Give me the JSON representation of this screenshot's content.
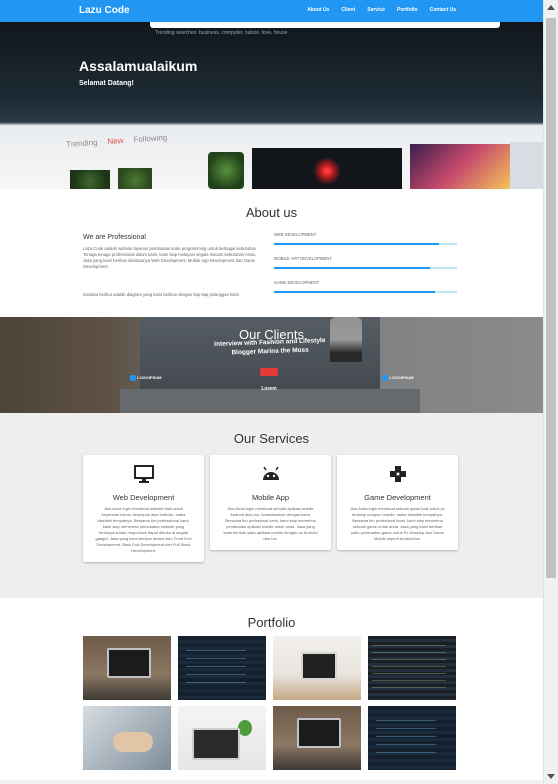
{
  "navbar": {
    "brand": "Lazu Code",
    "links": [
      "About Us",
      "Client",
      "Service",
      "Portfolio",
      "Contact Us"
    ]
  },
  "hero": {
    "trending": "Trending searches: business, computer, nature, love, house",
    "title": "Assalamualaikum",
    "subtitle": "Selamat Datang!",
    "tabs": [
      "Trending",
      "New",
      "Following"
    ]
  },
  "about": {
    "title": "About us",
    "heading": "We are Professional",
    "text": "Lazu Code adalah website layanan pembuatan kode programming untuk berbagai kebutuhan. Tenaga tenaga professional dalam kami, kami siap melayani segala macam kebutuhan Anda. Jasa yang kami berikan diantaranya Web Development, Mobile App Development dan Game Development.",
    "quote": "Gambar berikut adalah diagram yang kami berikan dengan tiap-tiap pelanggan kami",
    "skills": [
      {
        "label": "WEB DEVELOPMENT",
        "value": 0.9
      },
      {
        "label": "MOBILE APP DEVELOPMENT",
        "value": 0.85
      },
      {
        "label": "GAME DEVELOPMENT",
        "value": 0.88
      }
    ]
  },
  "clients": {
    "title": "Our Clients",
    "banner_line1": "Interview with Fashion and Lifestyle",
    "banner_line2": "Blogger Marina the Moss",
    "logos": [
      "LOGOIPSUM",
      "Lorem",
      "LOGOIPSUM"
    ]
  },
  "services": {
    "title": "Our Services",
    "cards": [
      {
        "icon": "monitor-icon",
        "title": "Web Development",
        "text": "Jika Anda ingin membuat website baik untuk keperluan bisnis, kelompok atau individu, maka disinilah tempatnya. Bersama tim professional kami, kami siap menerima pembuatan website yang tentunya sudah responsive dapat dibuka di segala gadget. Jasa yang kami berikan antara lain, Front End Development, Back End Development dan Full Stack Development."
      },
      {
        "icon": "android-icon",
        "title": "Mobile App",
        "text": "Jika Anda ingin membuat sebuah aplikasi mobile Android atau Ios, konsultasikan dengan kami. Bersama tim profesional kami, kami siap menerima pembuatan aplikasi mobile untuk anda. Jasa yang kami berikan yaitu aplikasi mobile dengan os Android dan Ios."
      },
      {
        "icon": "gamepad-icon",
        "title": "Game Development",
        "text": "Jika Anda ingin membuat sebuah game baik untuk pc desktop maupun mobile, maka disinilah tempatnya. Bersama tim profesional kami, kami siap menerima sebuah game untuk anda. Jasa yang kami berikan yaitu pembuatan game untuk Pc Desktop dan Game Mobile seperti Android/Ios."
      }
    ]
  },
  "portfolio": {
    "title": "Portfolio"
  }
}
